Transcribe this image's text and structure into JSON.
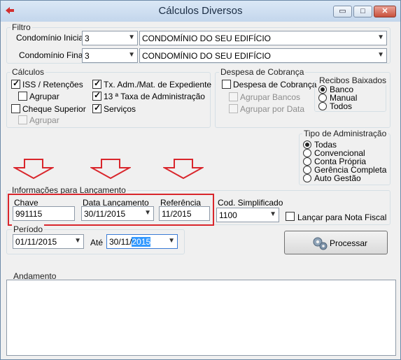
{
  "window": {
    "title": "Cálculos Diversos",
    "minimize_glyph": "▭",
    "maximize_glyph": "□",
    "close_glyph": "✕",
    "icon": "red-arrow-icon"
  },
  "filtro": {
    "legend": "Filtro",
    "inicial": {
      "label": "Condomínio Inicial",
      "code": "3",
      "name": "CONDOMÍNIO DO SEU EDIFÍCIO"
    },
    "final": {
      "label": "Condomínio Final",
      "code": "3",
      "name": "CONDOMÍNIO DO SEU EDIFÍCIO"
    }
  },
  "calculos": {
    "legend": "Cálculos",
    "iss": "ISS / Retenções",
    "agrupar": "Agrupar",
    "cheque": "Cheque Superior",
    "agrupar2": "Agrupar",
    "tx": "Tx. Adm./Mat. de Expediente",
    "taxa13": "13 ª Taxa de Administração",
    "servicos": "Serviços"
  },
  "despesa": {
    "legend": "Despesa de Cobrança",
    "check": "Despesa de Cobrança",
    "agrupar_bancos": "Agrupar Bancos",
    "agrupar_data": "Agrupar por Data",
    "recibos": {
      "legend": "Recibos Baixados",
      "options": [
        "Banco",
        "Manual",
        "Todos"
      ]
    }
  },
  "tipo_admin": {
    "legend": "Tipo de Administração",
    "options": [
      "Todas",
      "Convencional",
      "Conta Própria",
      "Gerência Completa",
      "Auto Gestão"
    ]
  },
  "lancamento": {
    "legend": "Informações para Lançamento",
    "chave_label": "Chave",
    "chave_value": "991115",
    "data_label": "Data Lançamento",
    "data_value": "30/11/2015",
    "ref_label": "Referência",
    "ref_value": "11/2015",
    "cod_label": "Cod. Simplificado",
    "cod_value": "1100",
    "nota_label": "Lançar para Nota Fiscal"
  },
  "periodo": {
    "legend": "Período",
    "de_value": "01/11/2015",
    "ate_label": "Até",
    "ate_prefix": "30/11/",
    "ate_selected": "2015"
  },
  "processar_label": "Processar",
  "andamento_legend": "Andamento",
  "colors": {
    "annotation_red": "#d9262c",
    "title_bar": "#c3d6ec"
  }
}
